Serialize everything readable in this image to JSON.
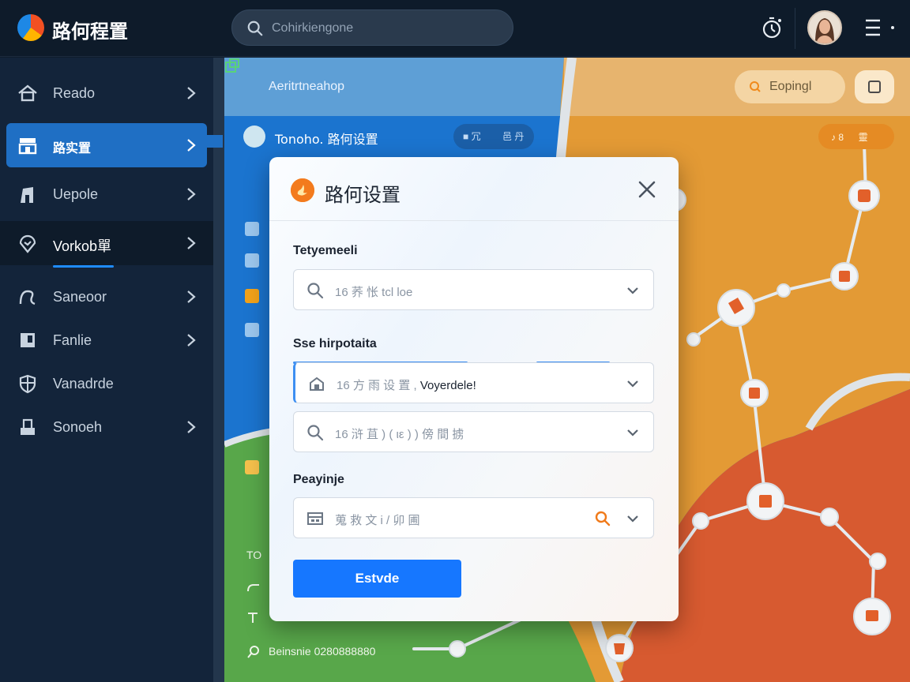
{
  "app": {
    "title": "路何程置"
  },
  "header": {
    "search_placeholder": "Cohirkiengone"
  },
  "sidebar": {
    "items": [
      {
        "label": "Reado",
        "icon": "home-icon"
      },
      {
        "label": "路实置",
        "icon": "storefront-icon"
      },
      {
        "label": "Uepole",
        "icon": "building-icon"
      },
      {
        "label": "Vorkob單",
        "icon": "location-pin-icon"
      },
      {
        "label": "Saneoor",
        "icon": "route-icon"
      },
      {
        "label": "Fanlie",
        "icon": "book-icon"
      },
      {
        "label": "Vanadrde",
        "icon": "shield-icon"
      },
      {
        "label": "Sonoeh",
        "icon": "inbox-icon"
      }
    ]
  },
  "map_panel": {
    "header_title": "Aeritrtneahop",
    "explore_label": "Eopingl",
    "route_title": "Tonoho. 路何设置",
    "chip_left": "■ 冗",
    "chip_right": "邑 丹",
    "orange_chip": "♪ 8 　 靈",
    "bottom_labels": [
      "TO",
      "Beinsnie 0280888880"
    ]
  },
  "dialog": {
    "title": "路何设置",
    "section1_label": "Tetyemeeli",
    "field1_value": "16 荞 怅 tcl loe",
    "section2_label": "Sse hirpotaita",
    "field2_prefix": "16 方 雨 设 置 ,",
    "field2_value": "Voyerdele!",
    "field3_value": "16 浒 苴 ) ( ιε ) ) 傍 間 掳",
    "section3_label": "Peayinje",
    "field4_value": "蒐 救 文 i / 卯 圃",
    "submit_label": "Estvde"
  },
  "colors": {
    "accent_blue": "#1677ff",
    "sidebar_active": "#1f6fc4",
    "map_blue": "#1b74cf",
    "map_orange": "#e3962f",
    "map_red": "#d95a2f",
    "map_green": "#5aa84a"
  }
}
